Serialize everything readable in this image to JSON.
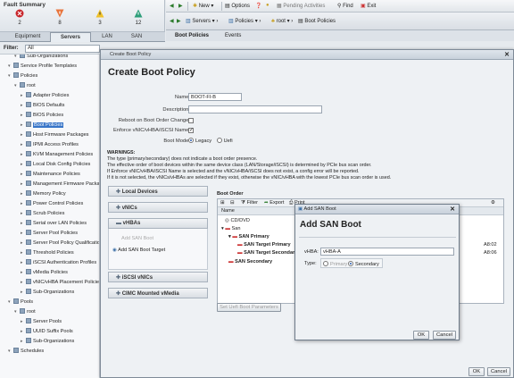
{
  "fault_summary": {
    "title": "Fault Summary",
    "counts": [
      "2",
      "8",
      "3",
      "12"
    ],
    "colors": [
      "#c8262b",
      "#e8743b",
      "#f0c22b",
      "#2e9e7a"
    ]
  },
  "topbar": {
    "new": "New",
    "options": "Options",
    "pending": "Pending Activities",
    "find": "Find",
    "exit": "Exit"
  },
  "breadcrumb": {
    "servers": "Servers",
    "policies": "Policies",
    "root": "root",
    "boot_policies": "Boot Policies"
  },
  "nav_tabs": [
    "Equipment",
    "Servers",
    "LAN",
    "SAN"
  ],
  "filter": {
    "label": "Filter:",
    "value": "All"
  },
  "tree": [
    {
      "label": "Sub-Organizations",
      "indent": 2
    },
    {
      "label": "Service Profile Templates",
      "indent": 1
    },
    {
      "label": "Policies",
      "indent": 1
    },
    {
      "label": "root",
      "indent": 2
    },
    {
      "label": "Adapter Policies",
      "indent": 3
    },
    {
      "label": "BIOS Defaults",
      "indent": 3
    },
    {
      "label": "BIOS Policies",
      "indent": 3
    },
    {
      "label": "Boot Policies",
      "indent": 3
    },
    {
      "label": "Host Firmware Packages",
      "indent": 3
    },
    {
      "label": "IPMI Access Profiles",
      "indent": 3
    },
    {
      "label": "KVM Management Policies",
      "indent": 3
    },
    {
      "label": "Local Disk Config Policies",
      "indent": 3
    },
    {
      "label": "Maintenance Policies",
      "indent": 3
    },
    {
      "label": "Management Firmware Packages",
      "indent": 3
    },
    {
      "label": "Memory Policy",
      "indent": 3
    },
    {
      "label": "Power Control Policies",
      "indent": 3
    },
    {
      "label": "Scrub Policies",
      "indent": 3
    },
    {
      "label": "Serial over LAN Policies",
      "indent": 3
    },
    {
      "label": "Server Pool Policies",
      "indent": 3
    },
    {
      "label": "Server Pool Policy Qualifications",
      "indent": 3
    },
    {
      "label": "Threshold Policies",
      "indent": 3
    },
    {
      "label": "iSCSI Authentication Profiles",
      "indent": 3
    },
    {
      "label": "vMedia Policies",
      "indent": 3
    },
    {
      "label": "vNIC/vHBA Placement Policies",
      "indent": 3
    },
    {
      "label": "Sub-Organizations",
      "indent": 3
    },
    {
      "label": "Pools",
      "indent": 1
    },
    {
      "label": "root",
      "indent": 2
    },
    {
      "label": "Server Pools",
      "indent": 3
    },
    {
      "label": "UUID Suffix Pools",
      "indent": 3
    },
    {
      "label": "Sub-Organizations",
      "indent": 3
    },
    {
      "label": "Schedules",
      "indent": 1
    }
  ],
  "right_tabs": [
    "Boot Policies",
    "Events"
  ],
  "dialog": {
    "window_title": "Create Boot Policy",
    "heading": "Create Boot Policy",
    "name_label": "Name:",
    "name_value": "BOOT-FI-B",
    "desc_label": "Description:",
    "reboot_label": "Reboot on Boot Order Change:",
    "enforce_label": "Enforce vNIC/vHBA/iSCSI Name:",
    "mode_label": "Boot Mode:",
    "mode_legacy": "Legacy",
    "mode_uefi": "Uefi",
    "warnings": [
      "WARNINGS:",
      "The type (primary/secondary) does not indicate a boot order presence.",
      "The effective order of boot devices within the same device class (LAN/Storage/iSCSI) is determined by PCIe bus scan order.",
      "If Enforce vNIC/vHBA/iSCSI Name is selected and the vNIC/vHBA/iSCSI does not exist, a config error will be reported.",
      "If it is not selected, the vNICs/vHBAs are selected if they exist, otherwise the vNIC/vHBA with the lowest PCIe bus scan order is used."
    ],
    "sections": [
      "Local Devices",
      "vNICs",
      "vHBAs",
      "iSCSI vNICs",
      "CIMC Mounted vMedia"
    ],
    "vhba_items": [
      "Add SAN Boot",
      "Add SAN Boot Target"
    ],
    "boot_order": {
      "title": "Boot Order",
      "toolbar": [
        "Filter",
        "Export",
        "Print"
      ],
      "col_name": "Name",
      "rows": [
        "CD/DVD",
        "San",
        "SAN Primary",
        "SAN Target Primary",
        "SAN Target Secondary",
        "SAN Secondary"
      ],
      "values": [
        "A8:02",
        "A8:06"
      ],
      "set_uefi": "Set Uefi Boot Parameters"
    },
    "ok": "OK",
    "cancel": "Cancel"
  },
  "san_dialog": {
    "window_title": "Add SAN Boot",
    "heading": "Add SAN Boot",
    "vhba_label": "vHBA:",
    "vhba_value": "vHBA-A",
    "type_label": "Type:",
    "primary": "Primary",
    "secondary": "Secondary",
    "ok": "OK",
    "cancel": "Cancel"
  }
}
